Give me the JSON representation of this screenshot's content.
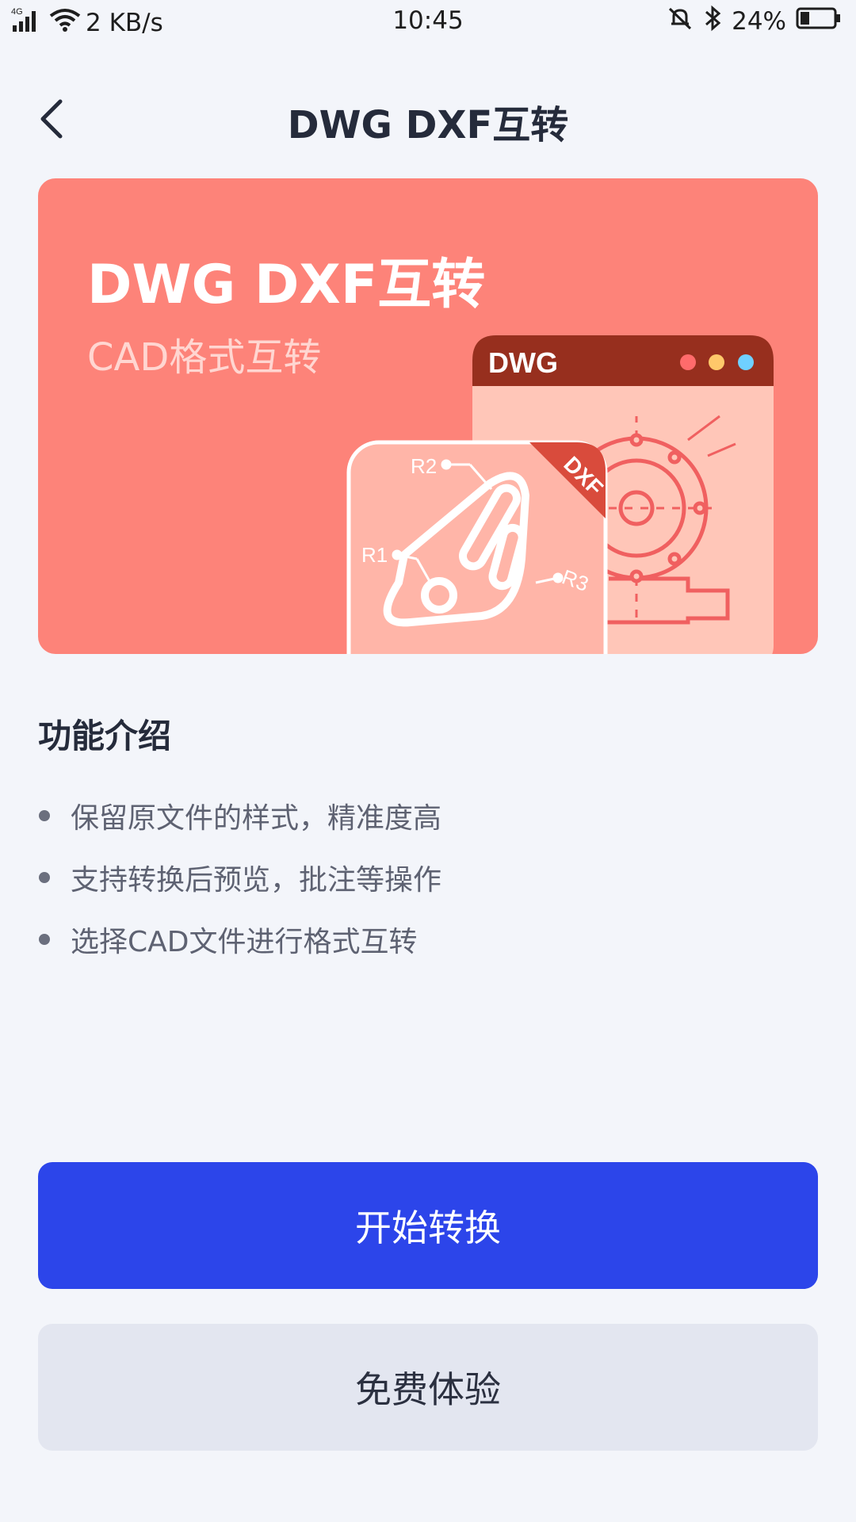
{
  "status_bar": {
    "network_type": "4G",
    "speed": "2 KB/s",
    "time": "10:45",
    "battery": "24%",
    "icons": [
      "signal-icon",
      "wifi-icon",
      "mute-icon",
      "bluetooth-icon",
      "battery-icon"
    ]
  },
  "header": {
    "title": "DWG DXF互转",
    "back_icon": "chevron-left-icon"
  },
  "banner": {
    "title": "DWG DXF互转",
    "subtitle": "CAD格式互转",
    "window_label": "DWG",
    "tag_label": "DXF",
    "dim_labels": [
      "R2",
      "R1",
      "R3"
    ],
    "colors": {
      "background": "#fd8379",
      "window_bar": "#972f1e"
    }
  },
  "features": {
    "title": "功能介绍",
    "items": [
      "保留原文件的样式，精准度高",
      "支持转换后预览，批注等操作",
      "选择CAD文件进行格式互转"
    ]
  },
  "actions": {
    "primary_label": "开始转换",
    "secondary_label": "免费体验",
    "primary_color": "#2c45ea"
  }
}
